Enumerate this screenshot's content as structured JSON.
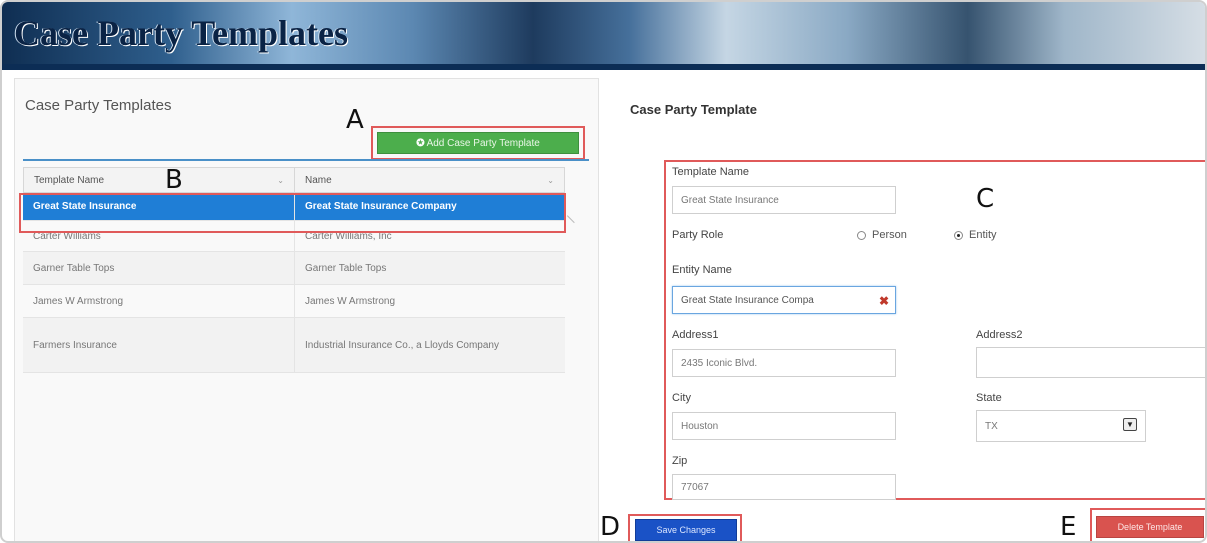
{
  "header": {
    "title": "Case Party Templates"
  },
  "left_panel": {
    "title": "Case Party Templates",
    "add_button_label": "Add Case Party Template",
    "table": {
      "columns": [
        "Template Name",
        "Name"
      ],
      "rows": [
        {
          "template_name": "Great State Insurance",
          "name": "Great State Insurance Company",
          "selected": true
        },
        {
          "template_name": "Carter Williams",
          "name": "Carter Williams, Inc"
        },
        {
          "template_name": "Garner Table Tops",
          "name": "Garner Table Tops"
        },
        {
          "template_name": "James W Armstrong",
          "name": "James W Armstrong"
        },
        {
          "template_name": "Farmers Insurance",
          "name": "Industrial Insurance Co., a Lloyds Company"
        }
      ]
    }
  },
  "callouts": {
    "a": "A",
    "b": "B",
    "c": "C",
    "d": "D",
    "e": "E"
  },
  "form": {
    "heading": "Case Party Template",
    "template_name_label": "Template Name",
    "template_name_value": "Great State Insurance",
    "party_role_label": "Party Role",
    "party_role_options": [
      "Person",
      "Entity"
    ],
    "party_role_selected": "Entity",
    "entity_name_label": "Entity Name",
    "entity_name_value": "Great State Insurance Compa",
    "address1_label": "Address1",
    "address1_value": "2435 Iconic Blvd.",
    "address2_label": "Address2",
    "address2_value": "",
    "city_label": "City",
    "city_value": "Houston",
    "state_label": "State",
    "state_value": "TX",
    "zip_label": "Zip",
    "zip_value": "77067"
  },
  "actions": {
    "save_label": "Save Changes",
    "delete_label": "Delete Template"
  },
  "colors": {
    "add_button": "#4cae4c",
    "save_button": "#1a52c6",
    "delete_button": "#d9534f",
    "selected_row": "#1f7ed6",
    "callout_border": "#e05a5a"
  }
}
